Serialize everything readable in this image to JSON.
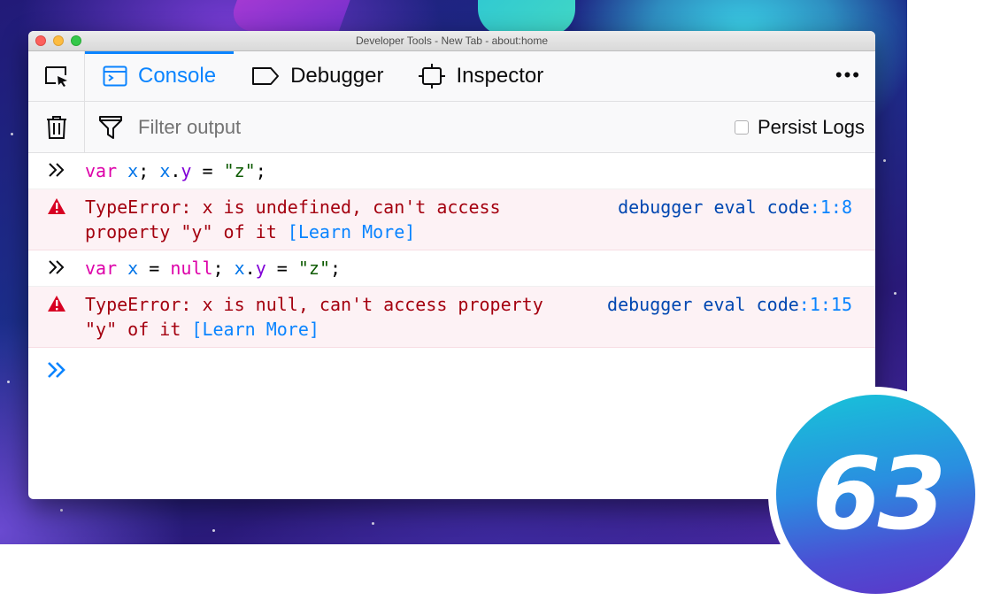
{
  "window": {
    "title": "Developer Tools - New Tab - about:home"
  },
  "tabs": [
    {
      "label": "Console",
      "icon": "console-icon",
      "selected": true
    },
    {
      "label": "Debugger",
      "icon": "debugger-icon",
      "selected": false
    },
    {
      "label": "Inspector",
      "icon": "inspector-icon",
      "selected": false
    }
  ],
  "more_menu": "•••",
  "toolbar": {
    "filter_placeholder": "Filter output",
    "persist_label": "Persist Logs",
    "persist_checked": false
  },
  "console": {
    "entries": [
      {
        "type": "input",
        "code": "var x; x.y = \"z\";"
      },
      {
        "type": "error",
        "message": "TypeError: x is undefined, can't access property \"y\" of it",
        "learn_more": "[Learn More]",
        "location": "debugger eval code",
        "line": ":1:8"
      },
      {
        "type": "input",
        "code": "var x = null; x.y = \"z\";"
      },
      {
        "type": "error",
        "message": "TypeError: x is null, can't access property \"y\" of it",
        "learn_more": "[Learn More]",
        "location": "debugger eval code",
        "line": ":1:15"
      }
    ]
  },
  "badge": {
    "version": "63"
  },
  "colors": {
    "accent": "#0a84ff",
    "error_text": "#a4000f",
    "error_bg": "#fdf2f5",
    "keyword": "#dd00a9"
  }
}
